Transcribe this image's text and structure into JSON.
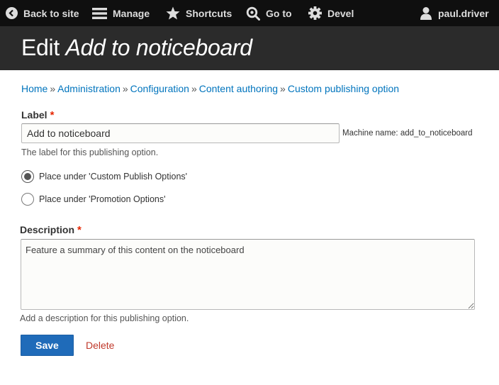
{
  "toolbar": {
    "back": "Back to site",
    "manage": "Manage",
    "shortcuts": "Shortcuts",
    "goto": "Go to",
    "devel": "Devel",
    "user": "paul.driver"
  },
  "page": {
    "title_prefix": "Edit",
    "title_item": "Add to noticeboard"
  },
  "breadcrumb": {
    "items": [
      "Home",
      "Administration",
      "Configuration",
      "Content authoring",
      "Custom publishing option"
    ],
    "separator": "»"
  },
  "form": {
    "label_field": {
      "label": "Label",
      "required_marker": "*",
      "value": "Add to noticeboard",
      "machine_name": "Machine name: add_to_noticeboard",
      "description": "The label for this publishing option."
    },
    "placement": {
      "options": [
        {
          "label": "Place under 'Custom Publish Options'",
          "checked": true
        },
        {
          "label": "Place under 'Promotion Options'",
          "checked": false
        }
      ]
    },
    "description_field": {
      "label": "Description",
      "required_marker": "*",
      "value": "Feature a summary of this content on the noticeboard",
      "description": "Add a description for this publishing option."
    },
    "actions": {
      "save": "Save",
      "delete": "Delete"
    }
  },
  "colors": {
    "toolbar_bg": "#0f0f0f",
    "header_bg": "#2b2b2b",
    "link": "#0074bd",
    "required": "#e62600",
    "primary_button": "#1f6bb9",
    "danger_link": "#c0392b"
  }
}
